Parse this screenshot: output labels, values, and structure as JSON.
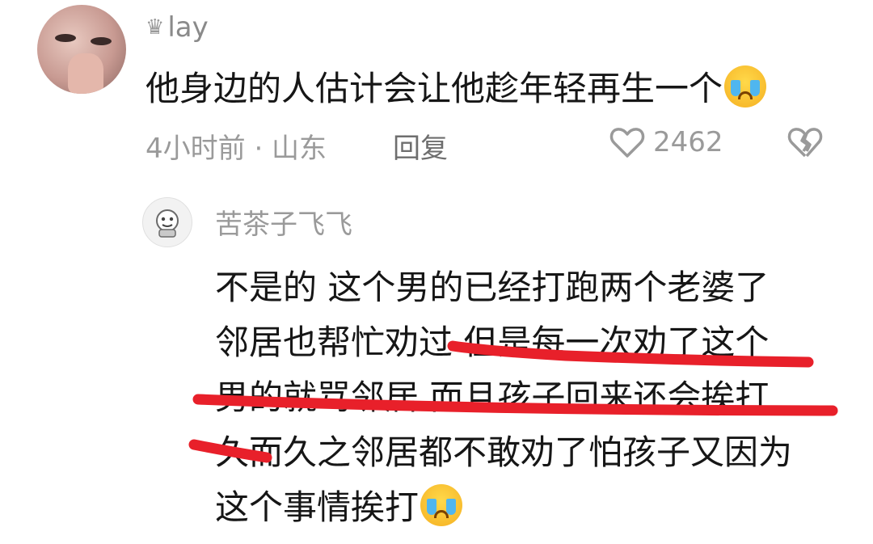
{
  "comment": {
    "username": "lay",
    "text": "他身边的人估计会让他趁年轻再生一个",
    "time_location": "4小时前 · 山东",
    "reply_label": "回复",
    "like_count": "2462"
  },
  "reply": {
    "username": "苦茶子飞飞",
    "lines": [
      "不是的 这个男的已经打跑两个老婆了",
      "邻居也帮忙劝过 但是每一次劝了这个",
      "男的就骂邻居 而且孩子回来还会挨打",
      "久而久之邻居都不敢劝了怕孩子又因为",
      "这个事情挨打"
    ]
  },
  "colors": {
    "text_primary": "#161616",
    "text_secondary": "#9a9a9a",
    "underline_red": "#e8202a"
  },
  "icons": [
    "crown-icon",
    "crying-emoji-icon",
    "heart-icon",
    "broken-heart-icon"
  ]
}
